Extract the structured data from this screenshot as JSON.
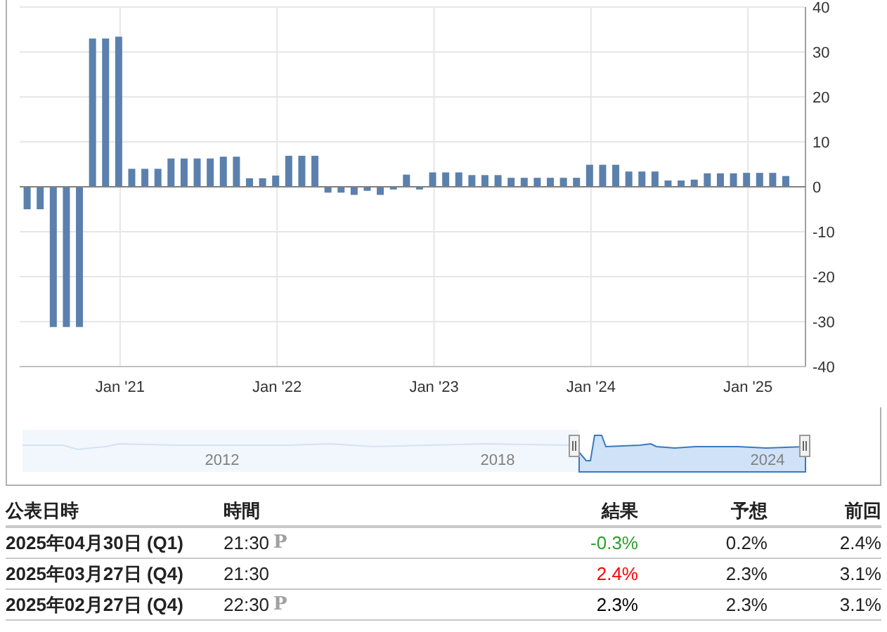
{
  "chart": {
    "chart_data": {
      "type": "bar",
      "grid": true,
      "categories": [
        null,
        null,
        null,
        null,
        null,
        null,
        null,
        "Jan '21",
        null,
        null,
        null,
        null,
        null,
        null,
        null,
        null,
        null,
        null,
        null,
        "Jan '22",
        null,
        null,
        null,
        null,
        null,
        null,
        null,
        null,
        null,
        null,
        null,
        "Jan '23",
        null,
        null,
        null,
        null,
        null,
        null,
        null,
        null,
        null,
        null,
        null,
        "Jan '24",
        null,
        null,
        null,
        null,
        null,
        null,
        null,
        null,
        null,
        null,
        null,
        "Jan '25",
        null,
        null,
        null
      ],
      "series": [
        {
          "color": "#5b80ad",
          "values": [
            -5,
            -5,
            -31.2,
            -31.2,
            -31.2,
            33,
            33,
            33.4,
            4,
            4,
            4,
            6.3,
            6.3,
            6.3,
            6.3,
            6.7,
            6.7,
            1.9,
            1.9,
            2.5,
            6.9,
            6.9,
            6.9,
            -1.3,
            -1.3,
            -1.8,
            -0.9,
            -1.8,
            -0.6,
            2.7,
            -0.6,
            3.2,
            3.2,
            3.2,
            2.6,
            2.6,
            2.6,
            2,
            2,
            2,
            2,
            2,
            2,
            4.9,
            4.9,
            4.9,
            3.4,
            3.4,
            3.4,
            1.4,
            1.4,
            1.6,
            3,
            3,
            3,
            3.1,
            3.1,
            3.1,
            2.4
          ]
        }
      ],
      "ylim": [
        -40,
        40
      ],
      "yticks": [
        -40,
        -30,
        -20,
        -10,
        0,
        10,
        20,
        30,
        40
      ]
    }
  },
  "navigator": {
    "labels": [
      "2012",
      "2018",
      "2024"
    ]
  },
  "table": {
    "columns": [
      "公表日時",
      "時間",
      "結果",
      "予想",
      "前回"
    ],
    "rows": [
      {
        "date": "2025年04月30日 (Q1)",
        "time": "21:30",
        "flag": "P",
        "actual": "-0.3%",
        "color": "#2ba02b",
        "forecast": "0.2%",
        "previous": "2.4%"
      },
      {
        "date": "2025年03月27日 (Q4)",
        "time": "21:30",
        "actual": "2.4%",
        "color": "#ff0000",
        "forecast": "2.3%",
        "previous": "3.1%"
      },
      {
        "date": "2025年02月27日 (Q4)",
        "time": "22:30",
        "flag": "P",
        "actual": "2.3%",
        "color": "#000000",
        "forecast": "2.3%",
        "previous": "3.1%"
      }
    ]
  }
}
